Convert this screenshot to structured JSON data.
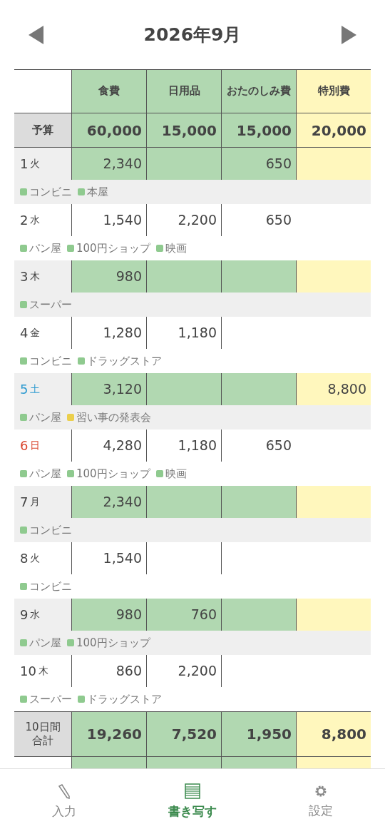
{
  "header": {
    "title": "2026年9月"
  },
  "table": {
    "columns": [
      {
        "label": "食費",
        "kind": "regular"
      },
      {
        "label": "日用品",
        "kind": "regular"
      },
      {
        "label": "おたのしみ費",
        "kind": "regular"
      },
      {
        "label": "特別費",
        "kind": "special"
      }
    ],
    "budget": {
      "label": "予算",
      "values": [
        "60,000",
        "15,000",
        "15,000",
        "20,000"
      ]
    },
    "days": [
      {
        "day": "1",
        "weekday": "火",
        "kind": "weekday",
        "amounts": {
          "column_1": "2,340",
          "column_3": "650"
        },
        "tags": [
          {
            "label": "コンビニ",
            "color": "#8fca8f"
          },
          {
            "label": "本屋",
            "color": "#8fca8f"
          }
        ]
      },
      {
        "day": "2",
        "weekday": "水",
        "kind": "weekday",
        "amounts": {
          "column_1": "1,540",
          "column_2": "2,200",
          "column_3": "650"
        },
        "tags": [
          {
            "label": "パン屋",
            "color": "#8fca8f"
          },
          {
            "label": "100円ショップ",
            "color": "#8fca8f"
          },
          {
            "label": "映画",
            "color": "#8fca8f"
          }
        ]
      },
      {
        "day": "3",
        "weekday": "木",
        "kind": "weekday",
        "amounts": {
          "column_1": "980"
        },
        "tags": [
          {
            "label": "スーパー",
            "color": "#8fca8f"
          }
        ]
      },
      {
        "day": "4",
        "weekday": "金",
        "kind": "weekday",
        "amounts": {
          "column_1": "1,280",
          "column_2": "1,180"
        },
        "tags": [
          {
            "label": "コンビニ",
            "color": "#8fca8f"
          },
          {
            "label": "ドラッグストア",
            "color": "#8fca8f"
          }
        ]
      },
      {
        "day": "5",
        "weekday": "土",
        "kind": "saturday",
        "amounts": {
          "column_1": "3,120",
          "column_4": "8,800"
        },
        "tags": [
          {
            "label": "パン屋",
            "color": "#8fca8f"
          },
          {
            "label": "習い事の発表会",
            "color": "#ebcf4c"
          }
        ]
      },
      {
        "day": "6",
        "weekday": "日",
        "kind": "sunday",
        "amounts": {
          "column_1": "4,280",
          "column_2": "1,180",
          "column_3": "650"
        },
        "tags": [
          {
            "label": "パン屋",
            "color": "#8fca8f"
          },
          {
            "label": "100円ショップ",
            "color": "#8fca8f"
          },
          {
            "label": "映画",
            "color": "#8fca8f"
          }
        ]
      },
      {
        "day": "7",
        "weekday": "月",
        "kind": "weekday",
        "amounts": {
          "column_1": "2,340"
        },
        "tags": [
          {
            "label": "コンビニ",
            "color": "#8fca8f"
          }
        ]
      },
      {
        "day": "8",
        "weekday": "火",
        "kind": "weekday",
        "amounts": {
          "column_1": "1,540"
        },
        "tags": [
          {
            "label": "コンビニ",
            "color": "#8fca8f"
          }
        ]
      },
      {
        "day": "9",
        "weekday": "水",
        "kind": "weekday",
        "amounts": {
          "column_1": "980",
          "column_2": "760"
        },
        "tags": [
          {
            "label": "パン屋",
            "color": "#8fca8f"
          },
          {
            "label": "100円ショップ",
            "color": "#8fca8f"
          }
        ]
      },
      {
        "day": "10",
        "weekday": "木",
        "kind": "weekday",
        "amounts": {
          "column_1": "860",
          "column_2": "2,200"
        },
        "tags": [
          {
            "label": "スーパー",
            "color": "#8fca8f"
          },
          {
            "label": "ドラッグストア",
            "color": "#8fca8f"
          }
        ]
      }
    ],
    "total": {
      "label": "10日間合計",
      "values": [
        "19,260",
        "7,520",
        "1,950",
        "8,800"
      ]
    }
  },
  "nav": [
    {
      "label": "入力",
      "selected": false
    },
    {
      "label": "書き写す",
      "selected": true
    },
    {
      "label": "設定",
      "selected": false
    }
  ]
}
